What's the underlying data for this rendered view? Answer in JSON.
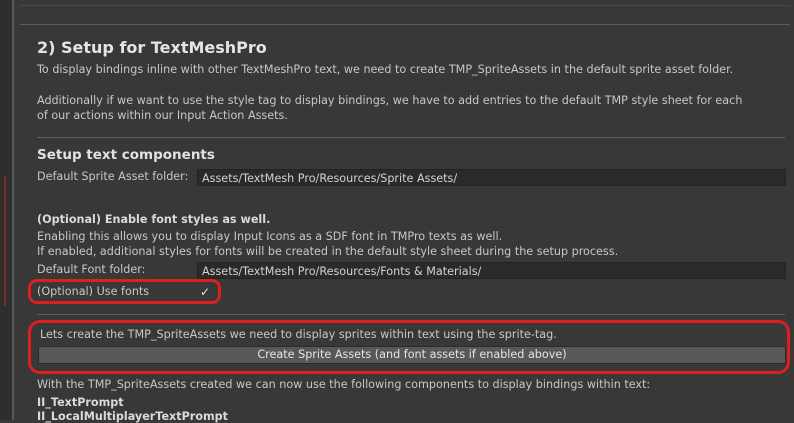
{
  "section": {
    "title": "2) Setup for TextMeshPro",
    "intro": "To display bindings inline with other TextMeshPro text, we need to create TMP_SpriteAssets in the default sprite asset folder.",
    "style_line1": "Additionally if we want to use the style tag to display bindings, we have to add entries to the default TMP style sheet for each",
    "style_line2": "of our actions within our Input Action Assets."
  },
  "components": {
    "heading": "Setup text components",
    "sprite_folder_label": "Default Sprite Asset folder:",
    "sprite_folder_value": "Assets/TextMesh Pro/Resources/Sprite Assets/"
  },
  "fonts": {
    "heading": "(Optional) Enable font styles as well.",
    "desc1": "Enabling this allows you to display Input Icons as a SDF font in TMPro texts as well.",
    "desc2": "If enabled,  additional styles for fonts will be created in the default style sheet during the setup process.",
    "folder_label": "Default Font folder:",
    "folder_value": "Assets/TextMesh Pro/Resources/Fonts & Materials/",
    "use_fonts_label": "(Optional) Use fonts",
    "use_fonts_checked": "✓"
  },
  "create": {
    "desc": "Lets create the TMP_SpriteAssets we need to display sprites within text using the sprite-tag.",
    "button_label": "Create Sprite Assets (and font assets if enabled above)",
    "after": "With the TMP_SpriteAssets created we can now use the following components to display bindings within text:"
  },
  "component_list": [
    "II_TextPrompt",
    "II_LocalMultiplayerTextPrompt"
  ],
  "colors": {
    "background": "#383838",
    "field_bg": "#2a2a2a",
    "button_bg": "#585858",
    "annotation": "#dd1f1f"
  }
}
